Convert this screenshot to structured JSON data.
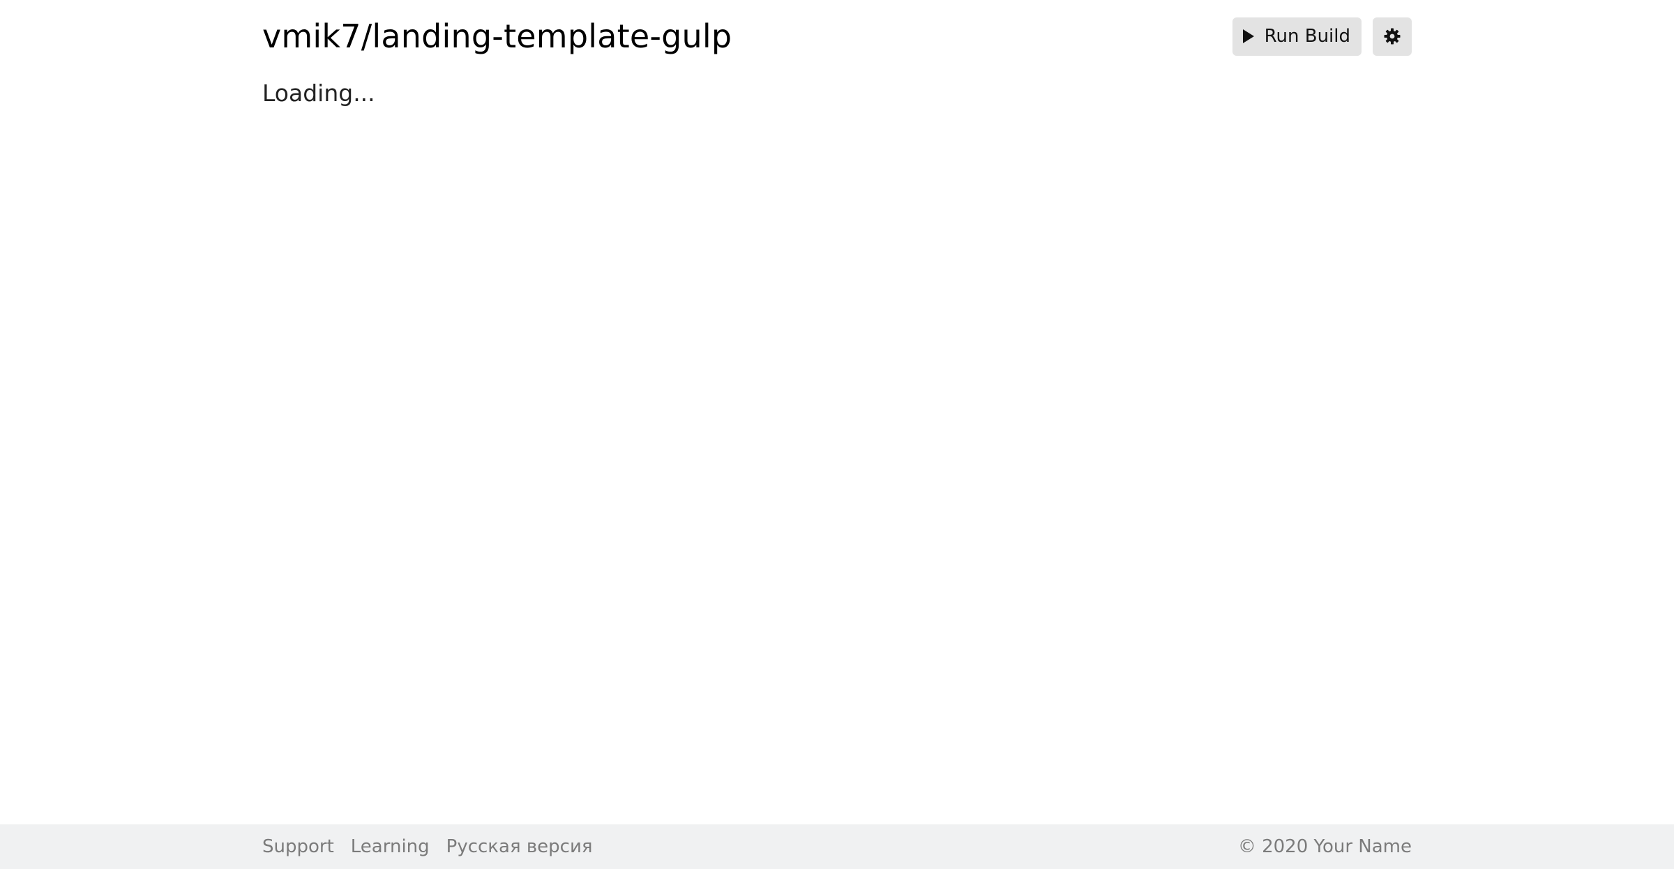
{
  "header": {
    "title": "vmik7/landing-template-gulp",
    "run_build_label": "Run Build",
    "run_icon": "play-icon",
    "settings_icon": "gear-icon"
  },
  "main": {
    "status_text": "Loading..."
  },
  "footer": {
    "links": [
      {
        "label": "Support"
      },
      {
        "label": "Learning"
      },
      {
        "label": "Русская версия"
      }
    ],
    "copyright": "© 2020 Your Name"
  },
  "colors": {
    "background": "#ffffff",
    "button_bg": "#e3e3e3",
    "footer_bg": "#f0f1f2",
    "footer_text": "#7b7b7b"
  }
}
